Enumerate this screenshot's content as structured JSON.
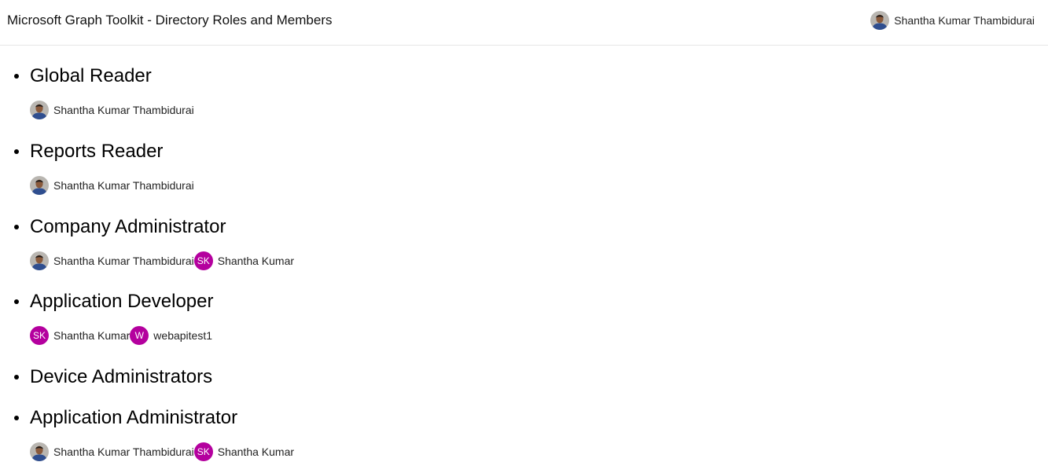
{
  "header": {
    "title": "Microsoft Graph Toolkit - Directory Roles and Members",
    "signed_in_user": "Shantha Kumar Thambidurai"
  },
  "roles": [
    {
      "name": "Global Reader",
      "members": [
        {
          "name": "Shantha Kumar Thambidurai",
          "avatar": "photo"
        }
      ]
    },
    {
      "name": "Reports Reader",
      "members": [
        {
          "name": "Shantha Kumar Thambidurai",
          "avatar": "photo"
        }
      ]
    },
    {
      "name": "Company Administrator",
      "members": [
        {
          "name": "Shantha Kumar Thambidurai",
          "avatar": "photo"
        },
        {
          "name": "Shantha Kumar",
          "avatar": "initials",
          "initials": "SK"
        }
      ]
    },
    {
      "name": "Application Developer",
      "members": [
        {
          "name": "Shantha Kumar",
          "avatar": "initials",
          "initials": "SK"
        },
        {
          "name": "webapitest1",
          "avatar": "initials",
          "initials": "W"
        }
      ]
    },
    {
      "name": "Device Administrators",
      "members": []
    },
    {
      "name": "Application Administrator",
      "members": [
        {
          "name": "Shantha Kumar Thambidurai",
          "avatar": "photo"
        },
        {
          "name": "Shantha Kumar",
          "avatar": "initials",
          "initials": "SK"
        }
      ]
    }
  ],
  "colors": {
    "initials_avatar_bg": "#b4009e",
    "header_border": "#e6e6e6"
  }
}
